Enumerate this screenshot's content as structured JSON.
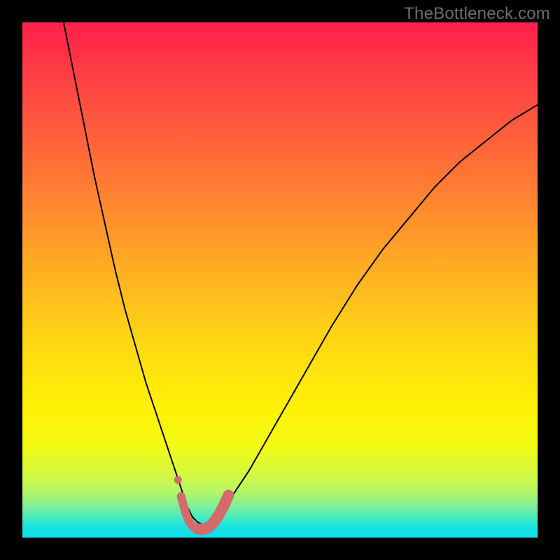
{
  "watermark": "TheBottleneck.com",
  "chart_data": {
    "type": "line",
    "title": "",
    "xlabel": "",
    "ylabel": "",
    "xlim": [
      0,
      100
    ],
    "ylim": [
      0,
      100
    ],
    "grid": false,
    "legend": false,
    "background": "vertical heat gradient (red→orange→yellow→green→teal)",
    "series": [
      {
        "name": "main-curve",
        "stroke": "#000000",
        "stroke_width": 2,
        "x": [
          8,
          10,
          12,
          14,
          16,
          18,
          20,
          22,
          24,
          26,
          28,
          30,
          31,
          32,
          33,
          34,
          35,
          36,
          38,
          40,
          44,
          48,
          52,
          56,
          60,
          65,
          70,
          75,
          80,
          85,
          90,
          95,
          100
        ],
        "y": [
          100,
          90,
          80,
          70,
          61,
          52,
          44,
          37,
          30,
          24,
          18,
          12,
          9,
          6,
          4,
          3,
          2.5,
          3,
          4.5,
          7,
          13,
          20,
          27,
          34,
          41,
          49,
          56,
          62,
          68,
          73,
          77,
          81,
          84
        ]
      },
      {
        "name": "minimum-highlight-left-dot",
        "type": "scatter",
        "stroke": "#d46a6a",
        "fill": "#d46a6a",
        "marker_radius": 5.5,
        "x": [
          30.2
        ],
        "y": [
          11.2
        ]
      },
      {
        "name": "minimum-highlight-left",
        "stroke": "#d46a6a",
        "stroke_width": 12,
        "linecap": "round",
        "x": [
          30.8,
          31.6,
          32.4,
          33.2,
          34.0
        ],
        "y": [
          8.0,
          5.0,
          3.0,
          2.0,
          1.7
        ]
      },
      {
        "name": "minimum-highlight-right",
        "stroke": "#d46a6a",
        "stroke_width": 16,
        "linecap": "round",
        "x": [
          34.0,
          35.0,
          36.0,
          37.0,
          38.0,
          39.0,
          40.0
        ],
        "y": [
          1.7,
          1.6,
          1.9,
          2.8,
          4.2,
          6.0,
          8.2
        ]
      }
    ]
  }
}
